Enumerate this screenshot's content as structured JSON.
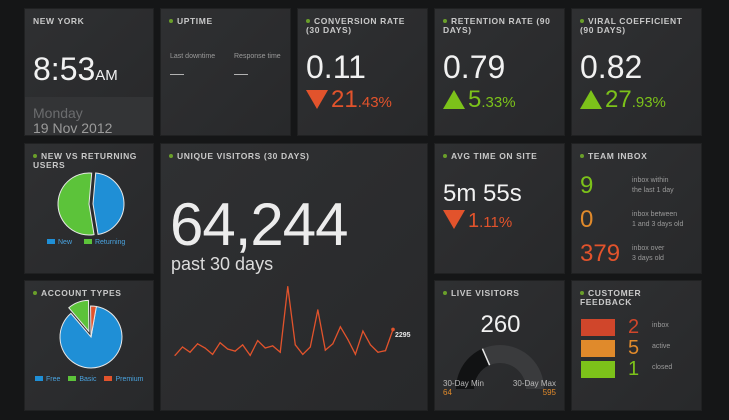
{
  "clock": {
    "title": "NEW YORK",
    "time": "8:53",
    "ampm": "AM",
    "weekday": "Monday",
    "date": "19 Nov 2012"
  },
  "uptime": {
    "title": "UPTIME",
    "last_downtime_label": "Last downtime",
    "last_downtime_value": "—",
    "response_time_label": "Response time",
    "response_time_value": "—"
  },
  "conversion": {
    "title": "CONVERSION RATE (30 DAYS)",
    "value": "0.11",
    "delta_int": "21",
    "delta_dec": ".43%",
    "direction": "down"
  },
  "retention": {
    "title": "RETENTION RATE (90 DAYS)",
    "value": "0.79",
    "delta_int": "5",
    "delta_dec": ".33%",
    "direction": "up"
  },
  "viral": {
    "title": "VIRAL COEFFICIENT (90 DAYS)",
    "value": "0.82",
    "delta_int": "27",
    "delta_dec": ".93%",
    "direction": "up"
  },
  "new_returning": {
    "title": "NEW VS RETURNING USERS",
    "legend_new": "New",
    "legend_returning": "Returning"
  },
  "unique_visitors": {
    "title": "UNIQUE VISITORS (30 DAYS)",
    "value": "64,244",
    "subtitle": "past 30 days",
    "last_label": "2295"
  },
  "avg_time": {
    "title": "AVG TIME ON SITE",
    "value": "5m 55s",
    "delta_int": "1",
    "delta_dec": ".11%",
    "direction": "down"
  },
  "team_inbox": {
    "title": "TEAM INBOX",
    "rows": [
      {
        "count": "9",
        "label1": "inbox within",
        "label2": "the last 1 day",
        "color": "#7cc21a"
      },
      {
        "count": "0",
        "label1": "inbox between",
        "label2": "1 and 3 days old",
        "color": "#e08a2b"
      },
      {
        "count": "379",
        "label1": "inbox over",
        "label2": "3 days old",
        "color": "#e2532c"
      }
    ]
  },
  "account_types": {
    "title": "ACCOUNT TYPES",
    "legend_free": "Free",
    "legend_basic": "Basic",
    "legend_premium": "Premium"
  },
  "live_visitors": {
    "title": "LIVE VISITORS",
    "value": "260",
    "min_label": "30-Day Min",
    "min_value": "64",
    "max_label": "30-Day Max",
    "max_value": "595"
  },
  "feedback": {
    "title": "CUSTOMER FEEDBACK",
    "rows": [
      {
        "count": "2",
        "label": "inbox",
        "color": "#d0462b"
      },
      {
        "count": "5",
        "label": "active",
        "color": "#e08a2b"
      },
      {
        "count": "1",
        "label": "closed",
        "color": "#7cc21a"
      }
    ]
  },
  "colors": {
    "accent_green": "#7cc21a",
    "accent_red": "#e2532c",
    "accent_orange": "#e08a2b",
    "accent_blue": "#1f8fd6",
    "tile_bg": "#2a2b2d"
  },
  "charts": {
    "new_returning_pie": {
      "type": "pie",
      "slices": [
        {
          "name": "New",
          "value": 46,
          "color": "#1f8fd6"
        },
        {
          "name": "Returning",
          "value": 54,
          "color": "#5cc33a"
        }
      ]
    },
    "account_types_pie": {
      "type": "pie",
      "slices": [
        {
          "name": "Free",
          "value": 86,
          "color": "#1f8fd6"
        },
        {
          "name": "Basic",
          "value": 11,
          "color": "#5cc33a"
        },
        {
          "name": "Premium",
          "value": 3,
          "color": "#e2532c"
        }
      ]
    },
    "unique_visitors_line": {
      "type": "line",
      "color": "#e2532c",
      "values": [
        2050,
        2130,
        2080,
        2160,
        2120,
        2060,
        2170,
        2110,
        2090,
        2150,
        2050,
        2190,
        2120,
        2140,
        2080,
        2700,
        2150,
        2060,
        2130,
        2480,
        2100,
        2160,
        2320,
        2200,
        2060,
        2280,
        2150,
        2080,
        2095,
        2295
      ],
      "ylim": [
        1950,
        2800
      ]
    },
    "live_gauge": {
      "min": 64,
      "max": 595,
      "value": 260
    }
  }
}
